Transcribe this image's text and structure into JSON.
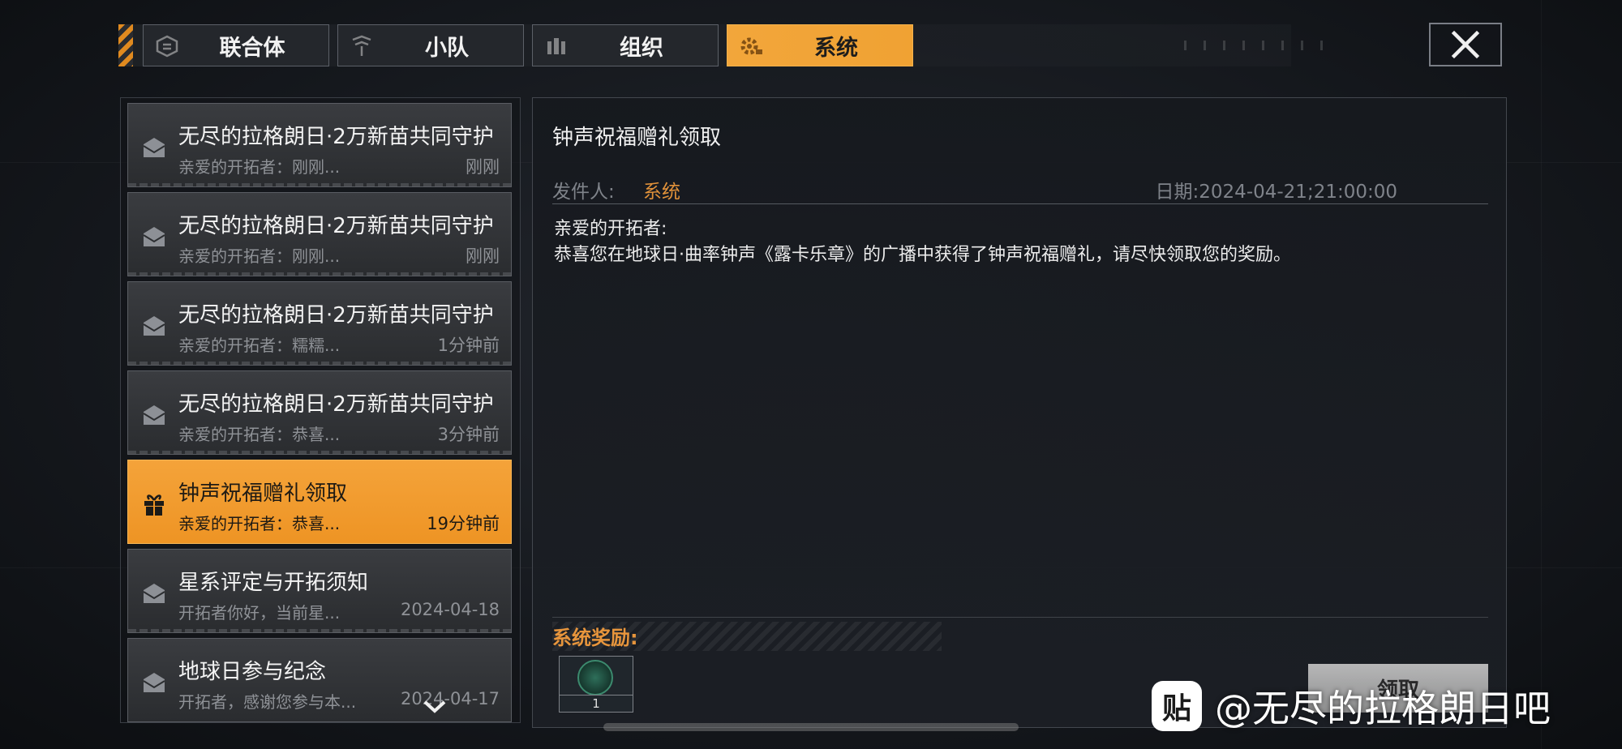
{
  "tabs": [
    {
      "label": "联合体",
      "icon": "alliance-icon"
    },
    {
      "label": "小队",
      "icon": "squad-icon"
    },
    {
      "label": "组织",
      "icon": "organization-icon"
    },
    {
      "label": "系统",
      "icon": "gear-icon",
      "active": true
    }
  ],
  "mail_list": [
    {
      "title": "无尽的拉格朗日·2万新苗共同守护",
      "preview": "亲爱的开拓者：刚刚...",
      "time": "刚刚",
      "icon": "envelope-icon"
    },
    {
      "title": "无尽的拉格朗日·2万新苗共同守护",
      "preview": "亲爱的开拓者：刚刚...",
      "time": "刚刚",
      "icon": "envelope-icon"
    },
    {
      "title": "无尽的拉格朗日·2万新苗共同守护",
      "preview": "亲爱的开拓者：糯糯...",
      "time": "1分钟前",
      "icon": "envelope-icon"
    },
    {
      "title": "无尽的拉格朗日·2万新苗共同守护",
      "preview": "亲爱的开拓者：恭喜...",
      "time": "3分钟前",
      "icon": "envelope-icon"
    },
    {
      "title": "钟声祝福赠礼领取",
      "preview": "亲爱的开拓者：恭喜...",
      "time": "19分钟前",
      "icon": "gift-icon",
      "selected": true
    },
    {
      "title": "星系评定与开拓须知",
      "preview": "开拓者你好，当前星...",
      "time": "2024-04-18",
      "icon": "envelope-icon"
    },
    {
      "title": "地球日参与纪念",
      "preview": "开拓者，感谢您参与本...",
      "time": "2024-04-17",
      "icon": "envelope-icon"
    }
  ],
  "detail": {
    "title": "钟声祝福赠礼领取",
    "sender_label": "发件人:",
    "sender": "系统",
    "date": "日期:2024-04-21;21:00:00",
    "greeting": "亲爱的开拓者:",
    "body": "恭喜您在地球日·曲率钟声《露卡乐章》的广播中获得了钟声祝福赠礼，请尽快领取您的奖励。",
    "reward_label": "系统奖励:",
    "reward_qty": "1",
    "claim_label": "领取"
  },
  "watermark": {
    "logo": "贴",
    "text": "@无尽的拉格朗日吧"
  },
  "colors": {
    "accent": "#f0a233",
    "sender": "#e0913a",
    "reward_label": "#e7953c"
  }
}
